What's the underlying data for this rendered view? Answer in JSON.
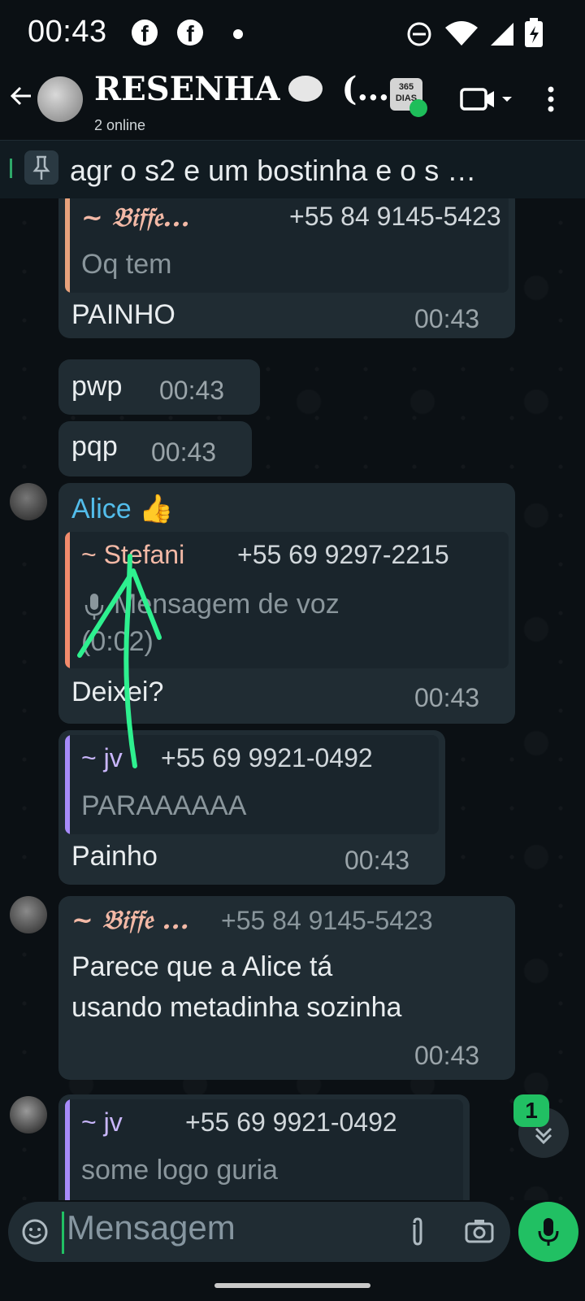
{
  "status": {
    "time": "00:43",
    "notif1": "f",
    "notif2": "f"
  },
  "header": {
    "title": "RESENHA",
    "title_suffix": "(…",
    "subtitle": "2 online",
    "badge": "365 DIAS"
  },
  "pinned": {
    "text": "agr o s2 e um bostinha e o s …"
  },
  "messages": [
    {
      "quote_name": "~ 𝔅𝔦𝔣𝔣𝔢...",
      "quote_phone": "+55 84 9145-5423",
      "quote_text": "Oq tem",
      "text": "PAINHO",
      "time": "00:43"
    },
    {
      "text": "pwp",
      "time": "00:43"
    },
    {
      "text": "pqp",
      "time": "00:43"
    },
    {
      "sender": "Alice 👍",
      "quote_name": "~ Stefani",
      "quote_phone": "+55 69 9297-2215",
      "quote_text_1": "Mensagem de voz",
      "quote_text_2": "(0:02)",
      "text": "Deixei?",
      "time": "00:43"
    },
    {
      "quote_name": "~ jv",
      "quote_phone": "+55 69 9921-0492",
      "quote_text": "PARAAAAAA",
      "text": "Painho",
      "time": "00:43"
    },
    {
      "sender": "~ 𝔅𝔦𝔣𝔣𝔢 ...",
      "sender_phone": "+55 84 9145-5423",
      "text_1": "Parece que a Alice tá",
      "text_2": "usando metadinha sozinha",
      "time": "00:43"
    },
    {
      "quote_name": "~ jv",
      "quote_phone": "+55 69 9921-0492",
      "quote_text": "some logo guria"
    }
  ],
  "unread_count": "1",
  "input": {
    "placeholder": "Mensagem"
  },
  "colors": {
    "accent": "#21c063",
    "bubble": "#202c33",
    "background": "#0b1014",
    "alice": "#53bdeb",
    "stefani_bar": "#f28b6c",
    "biffe": "#f3b9a6",
    "jv_bar": "#a78bfa",
    "annotation": "#2ef08f"
  },
  "icons": [
    "back-arrow-icon",
    "video-call-icon",
    "more-options-icon",
    "pin-icon",
    "microphone-icon",
    "emoji-icon",
    "attach-icon",
    "camera-icon",
    "scroll-down-icon"
  ]
}
